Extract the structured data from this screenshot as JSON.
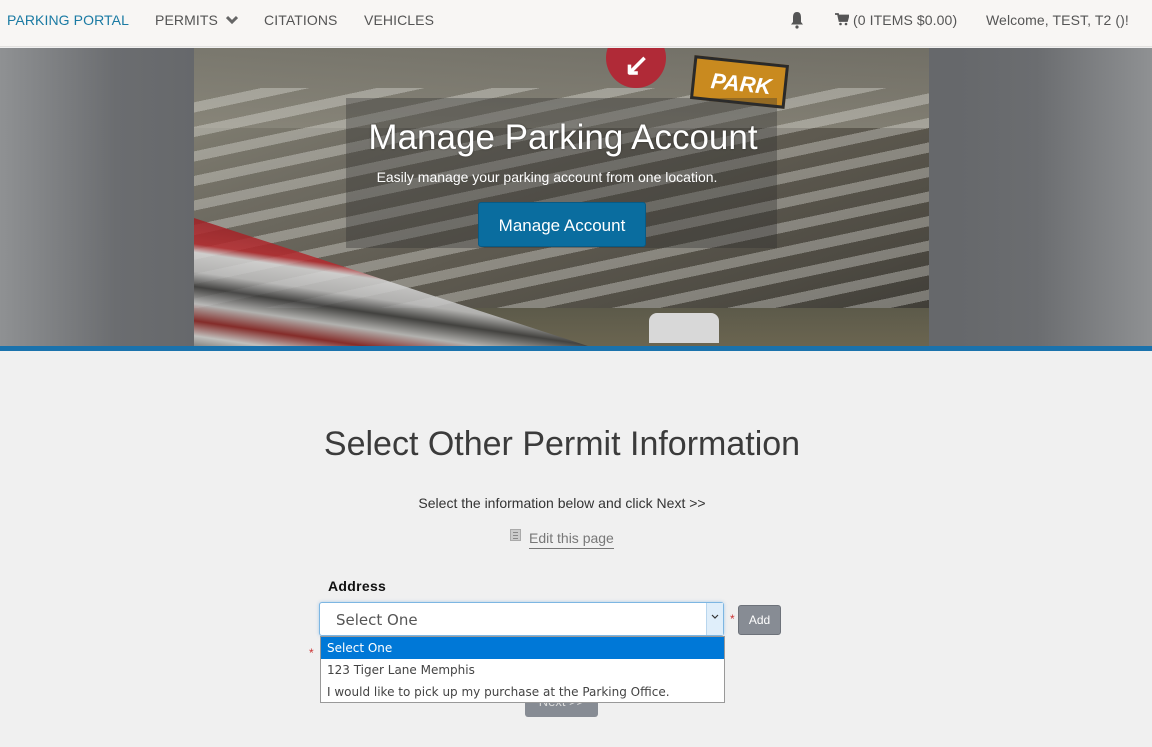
{
  "navbar": {
    "brand": "PARKING PORTAL",
    "items": [
      {
        "label": "PERMITS",
        "icon": "chevron-down-icon"
      },
      {
        "label": "CITATIONS"
      },
      {
        "label": "VEHICLES"
      }
    ],
    "notifications_icon": "bell-icon",
    "cart": {
      "icon": "cart-icon",
      "label": "(0 ITEMS $0.00)"
    },
    "welcome": "Welcome, TEST, T2 ()!"
  },
  "hero": {
    "title": "Manage Parking Account",
    "subtitle": "Easily manage your parking account from one location.",
    "button_label": "Manage Account",
    "image_sign_text": "PARK"
  },
  "main": {
    "title": "Select Other Permit Information",
    "instructions": "Select the information below and click Next >>",
    "edit_link": "Edit this page",
    "address": {
      "label": "Address",
      "selected": "Select One",
      "required_marker": "*",
      "add_label": "Add",
      "options": [
        "Select One",
        "123 Tiger Lane Memphis",
        "I would like to pick up my purchase at the Parking Office."
      ]
    },
    "next_label": "Next >>"
  },
  "colors": {
    "brand": "#1a7aa3",
    "primary_button": "#0a6d9f",
    "divider": "#1a72ac",
    "dropdown_highlight": "#0078d7",
    "secondary_button": "#878c94"
  }
}
